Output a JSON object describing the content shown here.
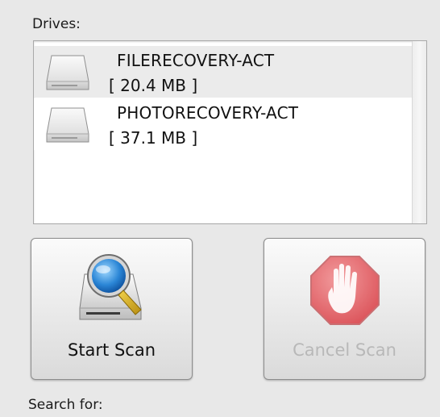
{
  "drives_label": "Drives:",
  "drives": [
    {
      "name": "FILERECOVERY-ACT",
      "size": "[ 20.4 MB ]",
      "icon": "drive-icon",
      "selected_look": true
    },
    {
      "name": "PHOTORECOVERY-ACT",
      "size": "[ 37.1 MB ]",
      "icon": "drive-icon",
      "selected_look": false
    }
  ],
  "buttons": {
    "start_scan": {
      "label": "Start Scan",
      "icon": "magnifier-drive-icon",
      "enabled": true
    },
    "cancel_scan": {
      "label": "Cancel Scan",
      "icon": "stop-hand-icon",
      "enabled": false
    }
  },
  "search_label": "Search for:",
  "colors": {
    "background": "#e8e8e8",
    "list_background": "#ffffff",
    "row_highlight": "#ebebeb",
    "disabled_text": "#b8b8b8",
    "stop_red": "#d9363e"
  }
}
